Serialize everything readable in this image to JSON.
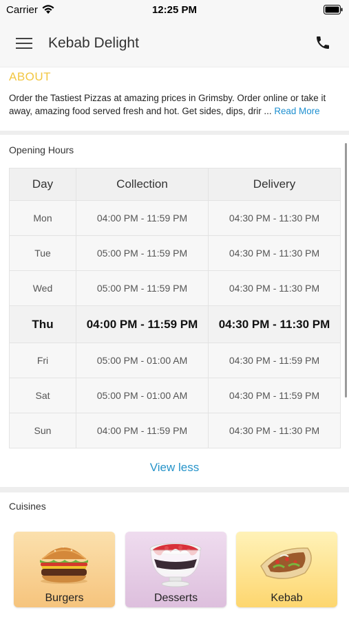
{
  "status_bar": {
    "carrier": "Carrier",
    "time": "12:25 PM"
  },
  "header": {
    "title": "Kebab Delight"
  },
  "about": {
    "title": "ABOUT",
    "text": "Order the Tastiest Pizzas at amazing prices in Grimsby. Order online or take it away, amazing food served fresh and hot. Get sides, dips, drir ...",
    "read_more": "Read More"
  },
  "opening_hours": {
    "label": "Opening Hours",
    "columns": [
      "Day",
      "Collection",
      "Delivery"
    ],
    "rows": [
      {
        "day": "Mon",
        "collection": "04:00 PM - 11:59 PM",
        "delivery": "04:30 PM - 11:30 PM"
      },
      {
        "day": "Tue",
        "collection": "05:00 PM - 11:59 PM",
        "delivery": "04:30 PM - 11:30 PM"
      },
      {
        "day": "Wed",
        "collection": "05:00 PM - 11:59 PM",
        "delivery": "04:30 PM - 11:30 PM"
      },
      {
        "day": "Thu",
        "collection": "04:00 PM - 11:59 PM",
        "delivery": "04:30 PM - 11:30 PM"
      },
      {
        "day": "Fri",
        "collection": "05:00 PM - 01:00 AM",
        "delivery": "04:30 PM - 11:59 PM"
      },
      {
        "day": "Sat",
        "collection": "05:00 PM - 01:00 AM",
        "delivery": "04:30 PM - 11:59 PM"
      },
      {
        "day": "Sun",
        "collection": "04:00 PM - 11:59 PM",
        "delivery": "04:30 PM - 11:30 PM"
      }
    ],
    "today": "Thu",
    "toggle": "View less"
  },
  "cuisines": {
    "label": "Cuisines",
    "items": [
      {
        "name": "Burgers",
        "icon": "burger-image"
      },
      {
        "name": "Desserts",
        "icon": "dessert-cup-image"
      },
      {
        "name": "Kebab",
        "icon": "kebab-wrap-image"
      }
    ]
  },
  "colors": {
    "about_title": "#f2c640",
    "link": "#1d8fd0",
    "view_less": "#2593c9",
    "icons": "#222222"
  }
}
